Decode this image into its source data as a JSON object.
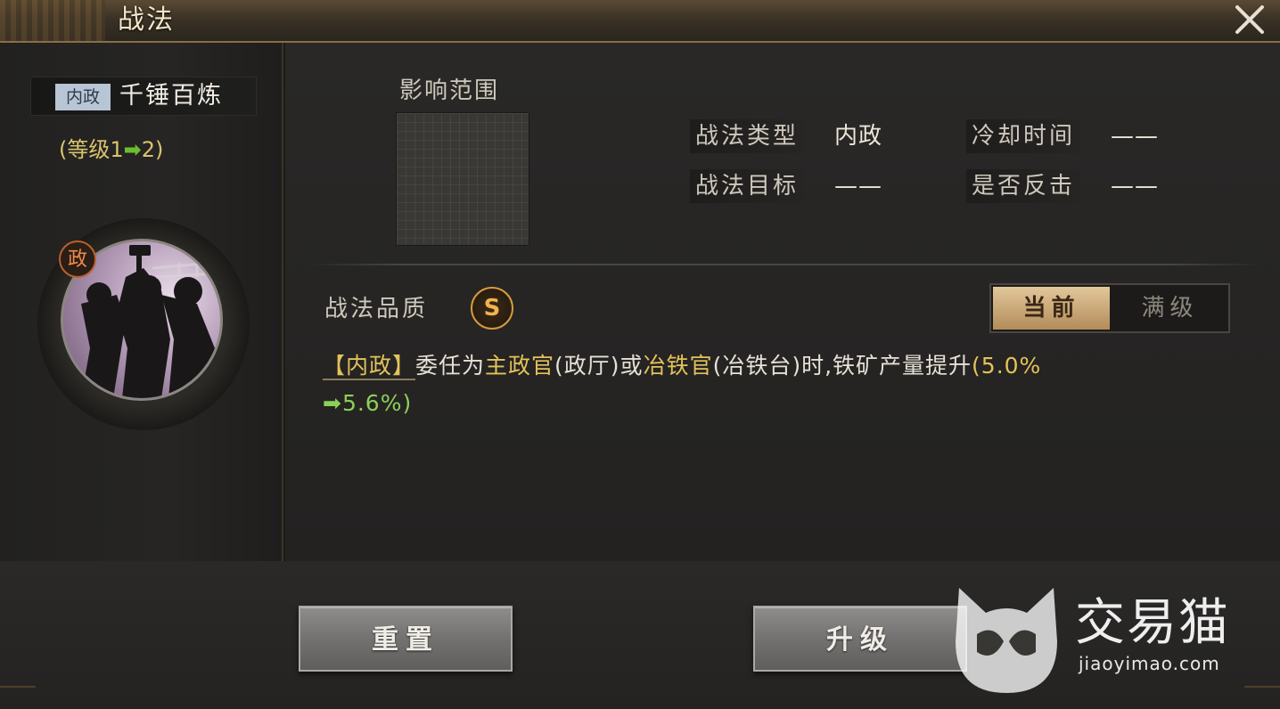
{
  "window": {
    "title": "战法",
    "close_icon": "close-icon"
  },
  "skill": {
    "type_tag": "内政",
    "name": "千锤百炼",
    "level_open": "(等级1",
    "level_arrow": "➡",
    "level_close": "2)",
    "portrait_badge": "政"
  },
  "range": {
    "label": "影响范围"
  },
  "attributes": {
    "type_label": "战法类型",
    "type_value": "内政",
    "cooldown_label": "冷却时间",
    "cooldown_value": "——",
    "target_label": "战法目标",
    "target_value": "——",
    "counter_label": "是否反击",
    "counter_value": "——"
  },
  "quality": {
    "label": "战法品质",
    "grade": "S"
  },
  "tabs": {
    "current": "当前",
    "max": "满级",
    "active": "current"
  },
  "description": {
    "tag": "【内政】",
    "part1": "委任为",
    "role1": "主政官",
    "part2": "(政厅)或",
    "role2": "冶铁官",
    "part3": "(冶铁台)时,铁矿产量提升",
    "value_open": "(5.0%",
    "arrow": "➡",
    "value_new": "5.6%)"
  },
  "buttons": {
    "reset": "重置",
    "upgrade": "升级"
  },
  "watermark": {
    "name": "交易猫",
    "url": "jiaoyimao.com"
  },
  "colors": {
    "highlight_yellow": "#e3c25a",
    "new_value_green": "#8bd05a",
    "quality_orange": "#f2b24e",
    "tag_blue": "#b7c5d4"
  }
}
